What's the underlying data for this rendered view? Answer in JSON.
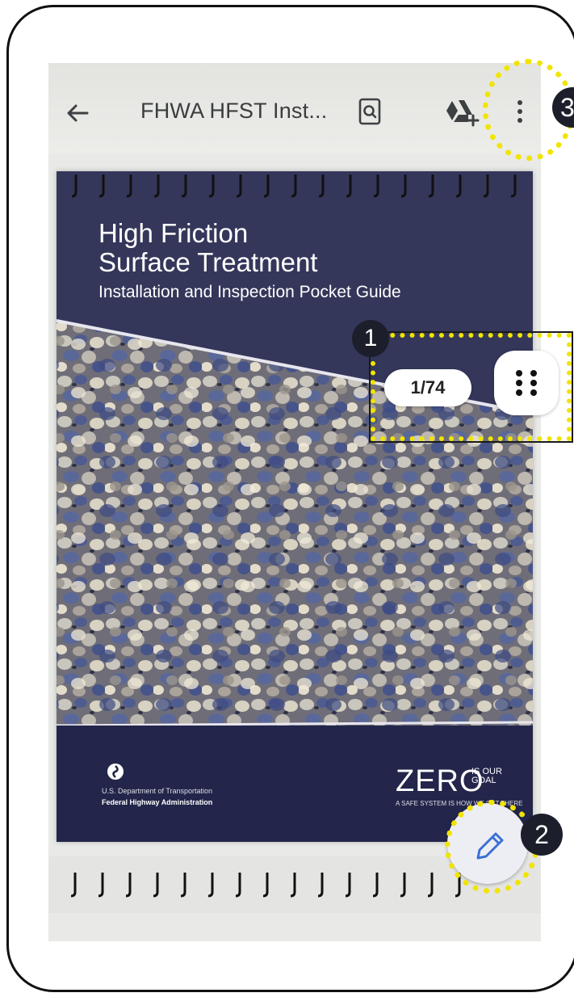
{
  "header": {
    "title": "FHWA HFST Inst...",
    "back_icon": "arrow-left-icon",
    "search_icon": "search-document-icon",
    "drive_icon": "add-to-drive-icon",
    "more_icon": "more-vert-icon"
  },
  "document": {
    "cover_title_line1": "High Friction",
    "cover_title_line2": "Surface Treatment",
    "cover_subtitle": "Installation and Inspection Pocket Guide",
    "agency_line1": "U.S. Department of Transportation",
    "agency_line2": "Federal Highway Administration",
    "zero_word": "ZERO",
    "zero_side_line1": "IS OUR",
    "zero_side_line2": "GOAL",
    "zero_tagline": "A SAFE SYSTEM IS HOW WE GET THERE"
  },
  "page_counter": {
    "label": "1/74"
  },
  "controls": {
    "grid_icon": "grid-dots-icon",
    "edit_icon": "pencil-icon"
  },
  "annotations": {
    "badge1": "1",
    "badge2": "2",
    "badge3": "3"
  },
  "colors": {
    "highlight": "#f1e400",
    "badge": "#1c1f2b",
    "cover_navy": "#2c2f4c",
    "edit_icon": "#3b6fd6"
  }
}
